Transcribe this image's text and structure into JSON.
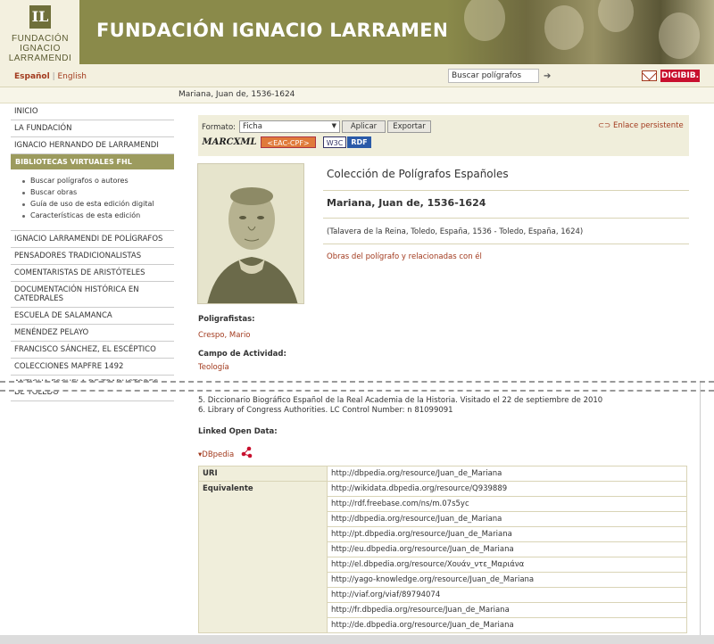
{
  "header": {
    "logo_text": [
      "FUNDACIÓN",
      "IGNACIO",
      "LARRAMENDI"
    ],
    "logo_mark": "IL",
    "banner_title": "FUNDACIÓN IGNACIO LARRAMENDI"
  },
  "topbar": {
    "lang_active": "Español",
    "lang_sep": "|",
    "lang_other": "English",
    "search_value": "Buscar polígrafos",
    "digibib": "DIGIBIB."
  },
  "breadcrumb": "Mariana, Juan de, 1536-1624",
  "sidebar": {
    "items_top": [
      "INICIO",
      "LA FUNDACIÓN",
      "IGNACIO HERNANDO DE LARRAMENDI"
    ],
    "section_header": "BIBLIOTECAS VIRTUALES FHL",
    "sub_items": [
      "Buscar polígrafos o autores",
      "Buscar obras",
      "Guía de uso de esta edición digital",
      "Características de esta edición"
    ],
    "items_bottom": [
      "IGNACIO LARRAMENDI DE POLÍGRAFOS",
      "PENSADORES TRADICIONALISTAS",
      "COMENTARISTAS DE ARISTÓTELES",
      "DOCUMENTACIÓN HISTÓRICA EN CATEDRALES",
      "ESCUELA DE SALAMANCA",
      "MENÉNDEZ PELAYO",
      "FRANCISCO SÁNCHEZ, EL ESCÉPTICO",
      "COLECCIONES MAPFRE 1492",
      "ANTIGUA ESCUELA DE TRADUCTORES DE TOLEDO"
    ]
  },
  "toolbar": {
    "format_label": "Formato:",
    "format_value": "Ficha",
    "apply_label": "Aplicar",
    "export_label": "Exportar",
    "permalink_label": "Enlace persistente",
    "badges": {
      "marc": "MARCXML",
      "eac": "<EAC-CPF>",
      "w3c": "W3C",
      "rdf": "RDF"
    }
  },
  "record": {
    "collection": "Colección de Polígrafos Españoles",
    "name": "Mariana, Juan de, 1536-1624",
    "place": "(Talavera de la Reina, Toledo, España, 1536 - Toledo, España, 1624)",
    "works_link": "Obras del polígrafo y relacionadas con él",
    "poligrafistas_label": "Poligrafistas:",
    "poligrafistas_value": "Crespo, Mario",
    "campo_label": "Campo de Actividad:",
    "campo_value": "Teología"
  },
  "references": [
    "5. Diccionario Biográfico Español de la Real Academia de la Historia. Visitado el 22 de septiembre de 2010",
    "6. Library of Congress Authorities. LC Control Number: n 81099091"
  ],
  "linked_open_data": {
    "label": "Linked Open Data:",
    "dbpedia_toggle": "DBpedia",
    "uri_key": "URI",
    "uri_value": "http://dbpedia.org/resource/Juan_de_Mariana",
    "equiv_key": "Equivalente",
    "equivalents": [
      "http://wikidata.dbpedia.org/resource/Q939889",
      "http://rdf.freebase.com/ns/m.07s5yc",
      "http://dbpedia.org/resource/Juan_de_Mariana",
      "http://pt.dbpedia.org/resource/Juan_de_Mariana",
      "http://eu.dbpedia.org/resource/Juan_de_Mariana",
      "http://el.dbpedia.org/resource/Χουάν_ντε_Μαριάνα",
      "http://yago-knowledge.org/resource/Juan_de_Mariana",
      "http://viaf.org/viaf/89794074",
      "http://fr.dbpedia.org/resource/Juan_de_Mariana",
      "http://de.dbpedia.org/resource/Juan_de_Mariana"
    ]
  }
}
